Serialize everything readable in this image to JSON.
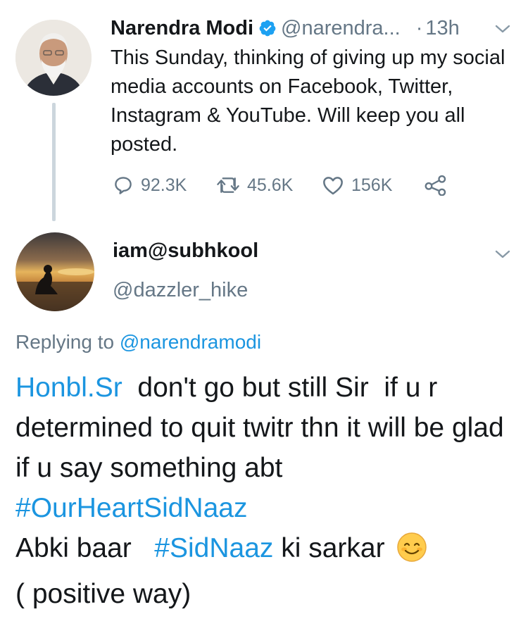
{
  "parent_tweet": {
    "author_name": "Narendra Modi",
    "author_handle": "@narendra...",
    "separator": "·",
    "time": "13h",
    "text": "This Sunday, thinking of giving up my social media accounts on Facebook, Twitter, Instagram & YouTube. Will keep you all posted.",
    "replies": "92.3K",
    "retweets": "45.6K",
    "likes": "156K",
    "icons": [
      "verified-badge-icon",
      "chevron-down-icon",
      "reply-icon",
      "retweet-icon",
      "like-icon",
      "share-icon"
    ]
  },
  "reply_tweet": {
    "author_name": "iam@subhkool",
    "author_handle": "@dazzler_hike",
    "replying_prefix": "Replying to",
    "replying_to": "@narendramodi",
    "text_parts": {
      "mention": "Honbl.Sr",
      "line1_rest": "  don't go but still Sir  if u r determined to quit twitr thn it will be glad if u say something abt ",
      "hashtag1": "#OurHeartSidNaaz",
      "line2_start": "Abki baar   ",
      "hashtag2": "#SidNaaz",
      "line2_end": " ki sarkar ",
      "line3": "( positive way)"
    },
    "icons": [
      "chevron-down-icon",
      "smiling-face-emoji"
    ]
  },
  "colors": {
    "link": "#1b95e0",
    "secondary_text": "#657786",
    "primary_text": "#14171a",
    "thread_line": "#ccd6dd"
  }
}
